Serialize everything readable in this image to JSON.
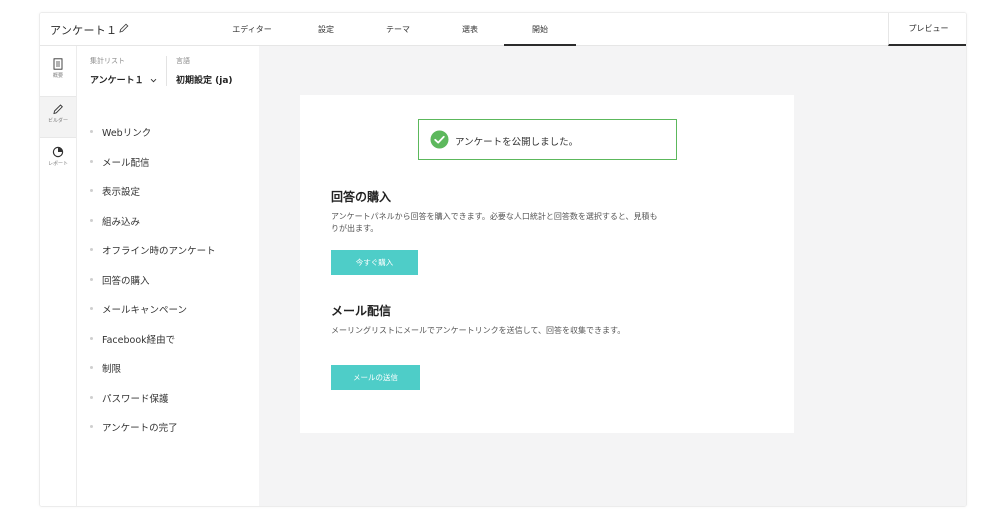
{
  "header": {
    "survey_title": "アンケート１",
    "tabs": [
      {
        "label": "エディター"
      },
      {
        "label": "設定"
      },
      {
        "label": "テーマ"
      },
      {
        "label": "選表"
      },
      {
        "label": "開始"
      }
    ],
    "active_tab": "開始",
    "preview_label": "プレビュー"
  },
  "rail": {
    "items": [
      {
        "label": "概要",
        "icon": "document-icon"
      },
      {
        "label": "ビルダー",
        "icon": "pencil-icon"
      },
      {
        "label": "レポート",
        "icon": "pie-chart-icon"
      }
    ],
    "active": "ビルダー"
  },
  "panel": {
    "list_label": "集計リスト",
    "list_value": "アンケート１",
    "language_label": "言語",
    "language_value": "初期設定 (ja)",
    "menu": [
      "Webリンク",
      "メール配信",
      "表示設定",
      "組み込み",
      "オフライン時のアンケート",
      "回答の購入",
      "メールキャンペーン",
      "Facebook経由で",
      "制限",
      "パスワード保護",
      "アンケートの完了"
    ]
  },
  "content": {
    "success_message": "アンケートを公開しました。",
    "purchase": {
      "title": "回答の購入",
      "description": "アンケートパネルから回答を購入できます。必要な人口統計と回答数を選択すると、見積もりが出ます。",
      "button": "今すぐ購入"
    },
    "email": {
      "title": "メール配信",
      "description": "メーリングリストにメールでアンケートリンクを送信して、回答を収集できます。",
      "button": "メールの送信"
    }
  },
  "colors": {
    "accent_teal": "#4ecdc8",
    "success_green": "#5cb85c",
    "content_bg": "#f4f4f5"
  }
}
